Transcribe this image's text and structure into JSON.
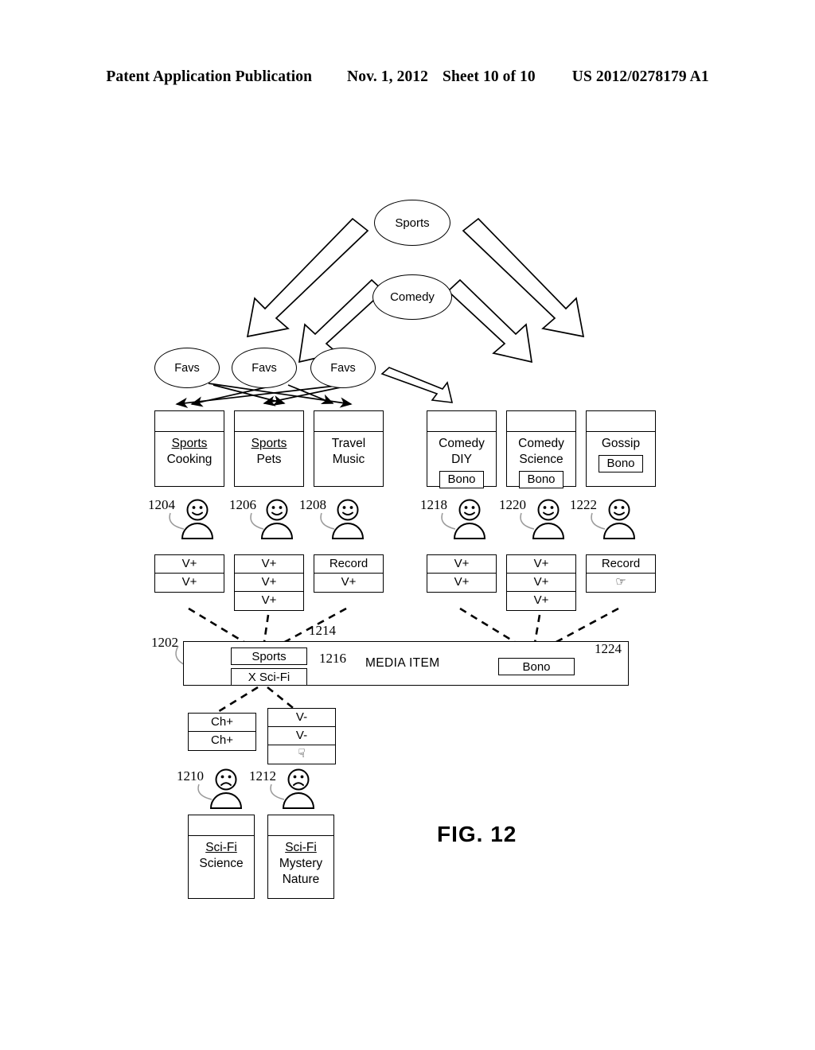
{
  "header": {
    "title": "Patent Application Publication",
    "date": "Nov. 1, 2012",
    "sheet": "Sheet 10 of 10",
    "number": "US 2012/0278179 A1"
  },
  "figure": {
    "caption": "FIG. 12"
  },
  "top_nodes": [
    {
      "label": "Sports"
    },
    {
      "label": "Comedy"
    }
  ],
  "favs_nodes": [
    {
      "label": "Favs"
    },
    {
      "label": "Favs"
    },
    {
      "label": "Favs"
    }
  ],
  "left_profiles": [
    {
      "lines": [
        {
          "text": "Sports",
          "underline": true
        },
        {
          "text": "Cooking",
          "underline": false
        }
      ],
      "badge": ""
    },
    {
      "lines": [
        {
          "text": "Sports",
          "underline": true
        },
        {
          "text": "Pets",
          "underline": false
        }
      ],
      "badge": ""
    },
    {
      "lines": [
        {
          "text": "Travel",
          "underline": false
        },
        {
          "text": "Music",
          "underline": false
        }
      ],
      "badge": ""
    }
  ],
  "right_profiles": [
    {
      "lines": [
        {
          "text": "Comedy",
          "underline": false
        },
        {
          "text": "DIY",
          "underline": false
        }
      ],
      "badge": "Bono"
    },
    {
      "lines": [
        {
          "text": "Comedy",
          "underline": false
        },
        {
          "text": "Science",
          "underline": false
        }
      ],
      "badge": "Bono"
    },
    {
      "lines": [
        {
          "text": "Gossip",
          "underline": false
        }
      ],
      "badge": "Bono"
    }
  ],
  "bottom_profiles": [
    {
      "lines": [
        {
          "text": "Sci-Fi",
          "underline": true
        },
        {
          "text": "Science",
          "underline": false
        }
      ],
      "badge": ""
    },
    {
      "lines": [
        {
          "text": "Sci-Fi",
          "underline": true
        },
        {
          "text": "Mystery",
          "underline": false
        },
        {
          "text": "Nature",
          "underline": false
        }
      ],
      "badge": ""
    }
  ],
  "persons": {
    "happy_left": [
      {
        "ref": "1204"
      },
      {
        "ref": "1206"
      },
      {
        "ref": "1208"
      }
    ],
    "happy_right": [
      {
        "ref": "1218"
      },
      {
        "ref": "1220"
      },
      {
        "ref": "1222"
      }
    ],
    "sad_bottom": [
      {
        "ref": "1210"
      },
      {
        "ref": "1212"
      }
    ]
  },
  "action_stacks": {
    "left": [
      {
        "actions": [
          {
            "label": "V+"
          },
          {
            "label": "V+"
          }
        ]
      },
      {
        "actions": [
          {
            "label": "V+"
          },
          {
            "label": "V+"
          },
          {
            "label": "V+"
          }
        ]
      },
      {
        "actions": [
          {
            "label": "Record"
          },
          {
            "label": "V+"
          }
        ]
      }
    ],
    "right": [
      {
        "actions": [
          {
            "label": "V+"
          },
          {
            "label": "V+"
          }
        ]
      },
      {
        "actions": [
          {
            "label": "V+"
          },
          {
            "label": "V+"
          },
          {
            "label": "V+"
          }
        ]
      },
      {
        "actions": [
          {
            "label": "Record"
          },
          {
            "label": "",
            "icon": "hand-up-icon"
          }
        ]
      }
    ],
    "bottom": [
      {
        "actions": [
          {
            "label": "Ch+"
          },
          {
            "label": "Ch+"
          }
        ]
      },
      {
        "actions": [
          {
            "label": "V-"
          },
          {
            "label": "V-"
          },
          {
            "label": "",
            "icon": "hand-down-icon"
          }
        ]
      }
    ]
  },
  "media_item": {
    "label": "MEDIA ITEM",
    "ref": "1202",
    "tags": [
      {
        "text": "Sports",
        "ref": "1214"
      },
      {
        "text": "X Sci-Fi",
        "ref": "1216"
      },
      {
        "text": "Bono",
        "ref": "1224"
      }
    ]
  },
  "colors": {
    "ink": "#000000",
    "paper": "#ffffff",
    "leader": "#9a9a9a"
  }
}
